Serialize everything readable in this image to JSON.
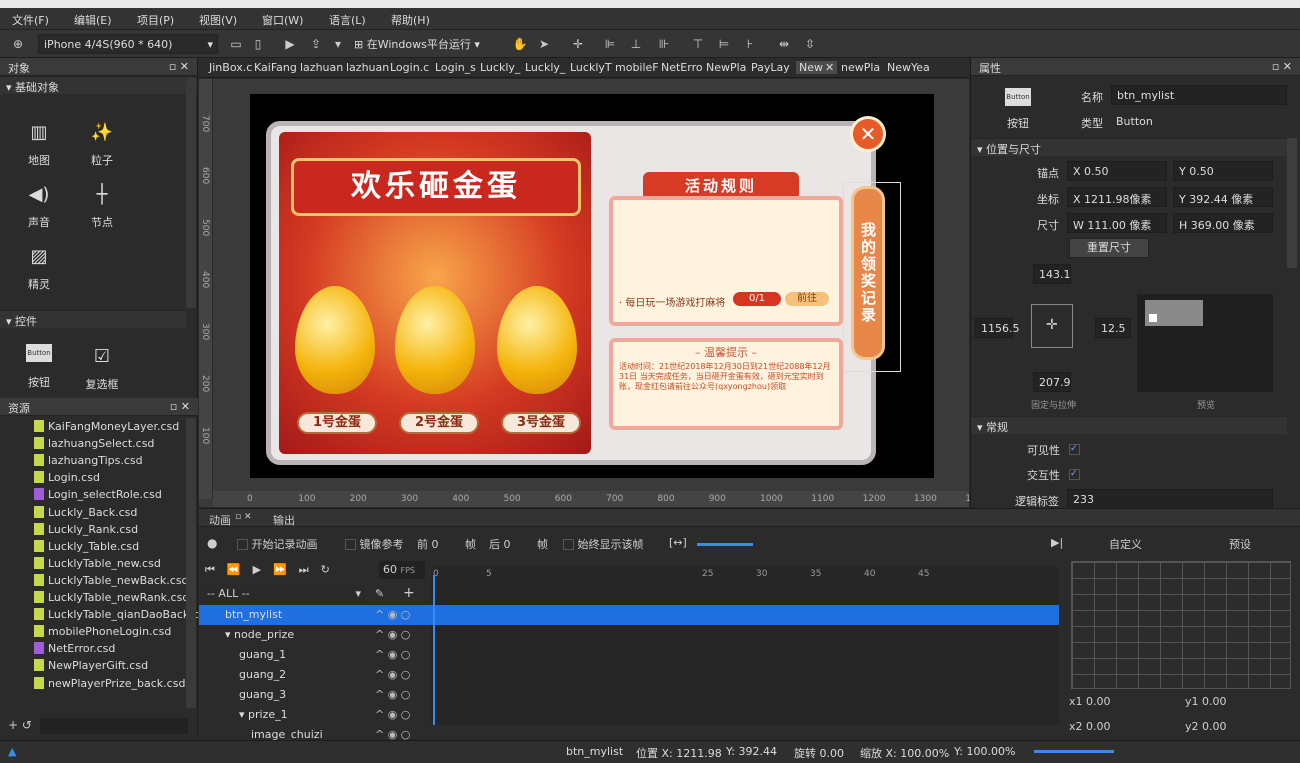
{
  "app": {
    "title": "Cocos Studio"
  },
  "menu": [
    "文件(F)",
    "编辑(E)",
    "项目(P)",
    "视图(V)",
    "窗口(W)",
    "语言(L)",
    "帮助(H)"
  ],
  "toolbar": {
    "device": "iPhone 4/4S(960 * 640)",
    "run_label": "在Windows平台运行"
  },
  "object_panel": {
    "title": "对象",
    "basic_section": "基础对象",
    "basic_items": [
      "地图",
      "粒子",
      "声音",
      "节点",
      "精灵"
    ],
    "controls_section": "控件",
    "control_items": [
      "按钮",
      "复选框"
    ]
  },
  "resource_panel": {
    "title": "资源",
    "files": [
      "KaiFangMoneyLayer.csd",
      "lazhuangSelect.csd",
      "lazhuangTips.csd",
      "Login.csd",
      "Login_selectRole.csd",
      "Luckly_Back.csd",
      "Luckly_Rank.csd",
      "Luckly_Table.csd",
      "LucklyTable_new.csd",
      "LucklyTable_newBack.csd",
      "LucklyTable_newRank.csd",
      "LucklyTable_qianDaoBack.c",
      "mobilePhoneLogin.csd",
      "NetError.csd",
      "NewPlayerGift.csd",
      "newPlayerPrize_back.csd"
    ]
  },
  "tabs": [
    "JinBox.c",
    "KaiFang",
    "lazhuan",
    "lazhuan",
    "Login.c",
    "Login_s",
    "Luckly_",
    "Luckly_",
    "LucklyT",
    "mobileF",
    "NetErro",
    "NewPla",
    "PayLay",
    "New",
    "newPla",
    "NewYea"
  ],
  "ruler": {
    "v": [
      "700",
      "600",
      "500",
      "400",
      "300",
      "200",
      "100"
    ],
    "h": [
      "0",
      "100",
      "200",
      "300",
      "400",
      "500",
      "600",
      "700",
      "800",
      "900",
      "1000",
      "1100",
      "1200",
      "1300",
      "14"
    ]
  },
  "game": {
    "title": "欢乐砸金蛋",
    "rules_title": "活动规则",
    "task_text": "· 每日玩一场游戏打麻将",
    "progress": "0/1",
    "go_btn": "前往",
    "tips_title": "– 温馨提示 –",
    "tips_text": "活动时间：21世纪2018年12月30日到21世纪2088年12月31日 当天完成任务，当日砸开金蛋有效，砸到元宝实时到账，现金红包请前往公众号(qxyongzhou)领取",
    "eggs": [
      "1号金蛋",
      "2号金蛋",
      "3号金蛋"
    ],
    "record_btn": "我的领奖记录"
  },
  "properties": {
    "title": "属性",
    "widget_type": "按钮",
    "icon_text": "Button",
    "name_label": "名称",
    "name": "btn_mylist",
    "type_label": "类型",
    "type": "Button",
    "pos_section": "位置与尺寸",
    "anchor_label": "锚点",
    "anchor_x": "X  0.50",
    "anchor_y": "Y  0.50",
    "pos_label": "坐标",
    "pos_x": "X  1211.98像素",
    "pos_y": "Y  392.44  像素",
    "size_label": "尺寸",
    "size_w": "W  111.00 像素",
    "size_h": "H  369.00 像素",
    "reset_btn": "重置尺寸",
    "margin_top": "143.1",
    "margin_left": "1156.5",
    "margin_right": "12.5",
    "margin_bottom": "207.9",
    "fix_label": "固定与拉伸",
    "preview_label": "预览",
    "general_section": "常规",
    "visible_label": "可见性",
    "interact_label": "交互性",
    "tag_label": "逻辑标签",
    "tag": "233"
  },
  "animation": {
    "tab1": "动画",
    "tab2": "输出",
    "record_label": "开始记录动画",
    "onion_label": "镜像参考",
    "prev_label": "前 0",
    "frame1": "帧",
    "next_label": "后 0",
    "frame2": "帧",
    "always_show": "始终显示该帧",
    "fps": "60",
    "fps_unit": "FPS",
    "filter": "-- ALL --",
    "frame_marks": [
      "0",
      "5",
      "25",
      "30",
      "35",
      "40",
      "45"
    ],
    "custom_label": "自定义",
    "preset_label": "预设",
    "x1": "x1  0.00",
    "y1": "y1  0.00",
    "x2": "x2  0.00",
    "y2": "y2  0.00",
    "nodes": [
      {
        "name": "btn_mylist",
        "indent": 40
      },
      {
        "name": "node_prize",
        "indent": 40
      },
      {
        "name": "guang_1",
        "indent": 54
      },
      {
        "name": "guang_2",
        "indent": 54
      },
      {
        "name": "guang_3",
        "indent": 54
      },
      {
        "name": "prize_1",
        "indent": 54
      },
      {
        "name": "image_chuizi",
        "indent": 66
      }
    ]
  },
  "status": {
    "name": "btn_mylist",
    "pos": "位置 X: 1211.98",
    "y": "Y: 392.44",
    "rot": "旋转 0.00",
    "scale_x": "缩放 X: 100.00%",
    "scale_y": "Y: 100.00%"
  }
}
